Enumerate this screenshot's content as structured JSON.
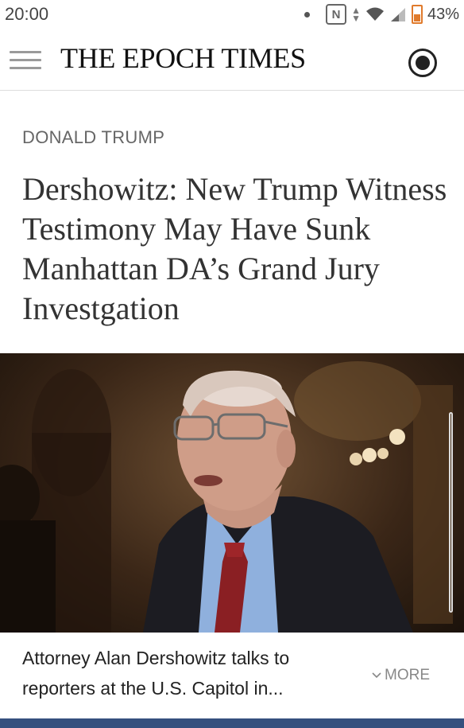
{
  "status_bar": {
    "time": "20:00",
    "battery": "43%"
  },
  "header": {
    "logo": "THE EPOCH TIMES"
  },
  "article": {
    "category": "DONALD TRUMP",
    "headline": "Dershowitz: New Trump Witness Testimony May Have Sunk Manhattan DA’s Grand Jury Investgation",
    "caption": "Attorney Alan Dershowitz talks to reporters at the U.S. Capitol in...",
    "more_label": "MORE"
  },
  "colors": {
    "brand_bar": "#35507e",
    "battery": "#e07a2b"
  }
}
